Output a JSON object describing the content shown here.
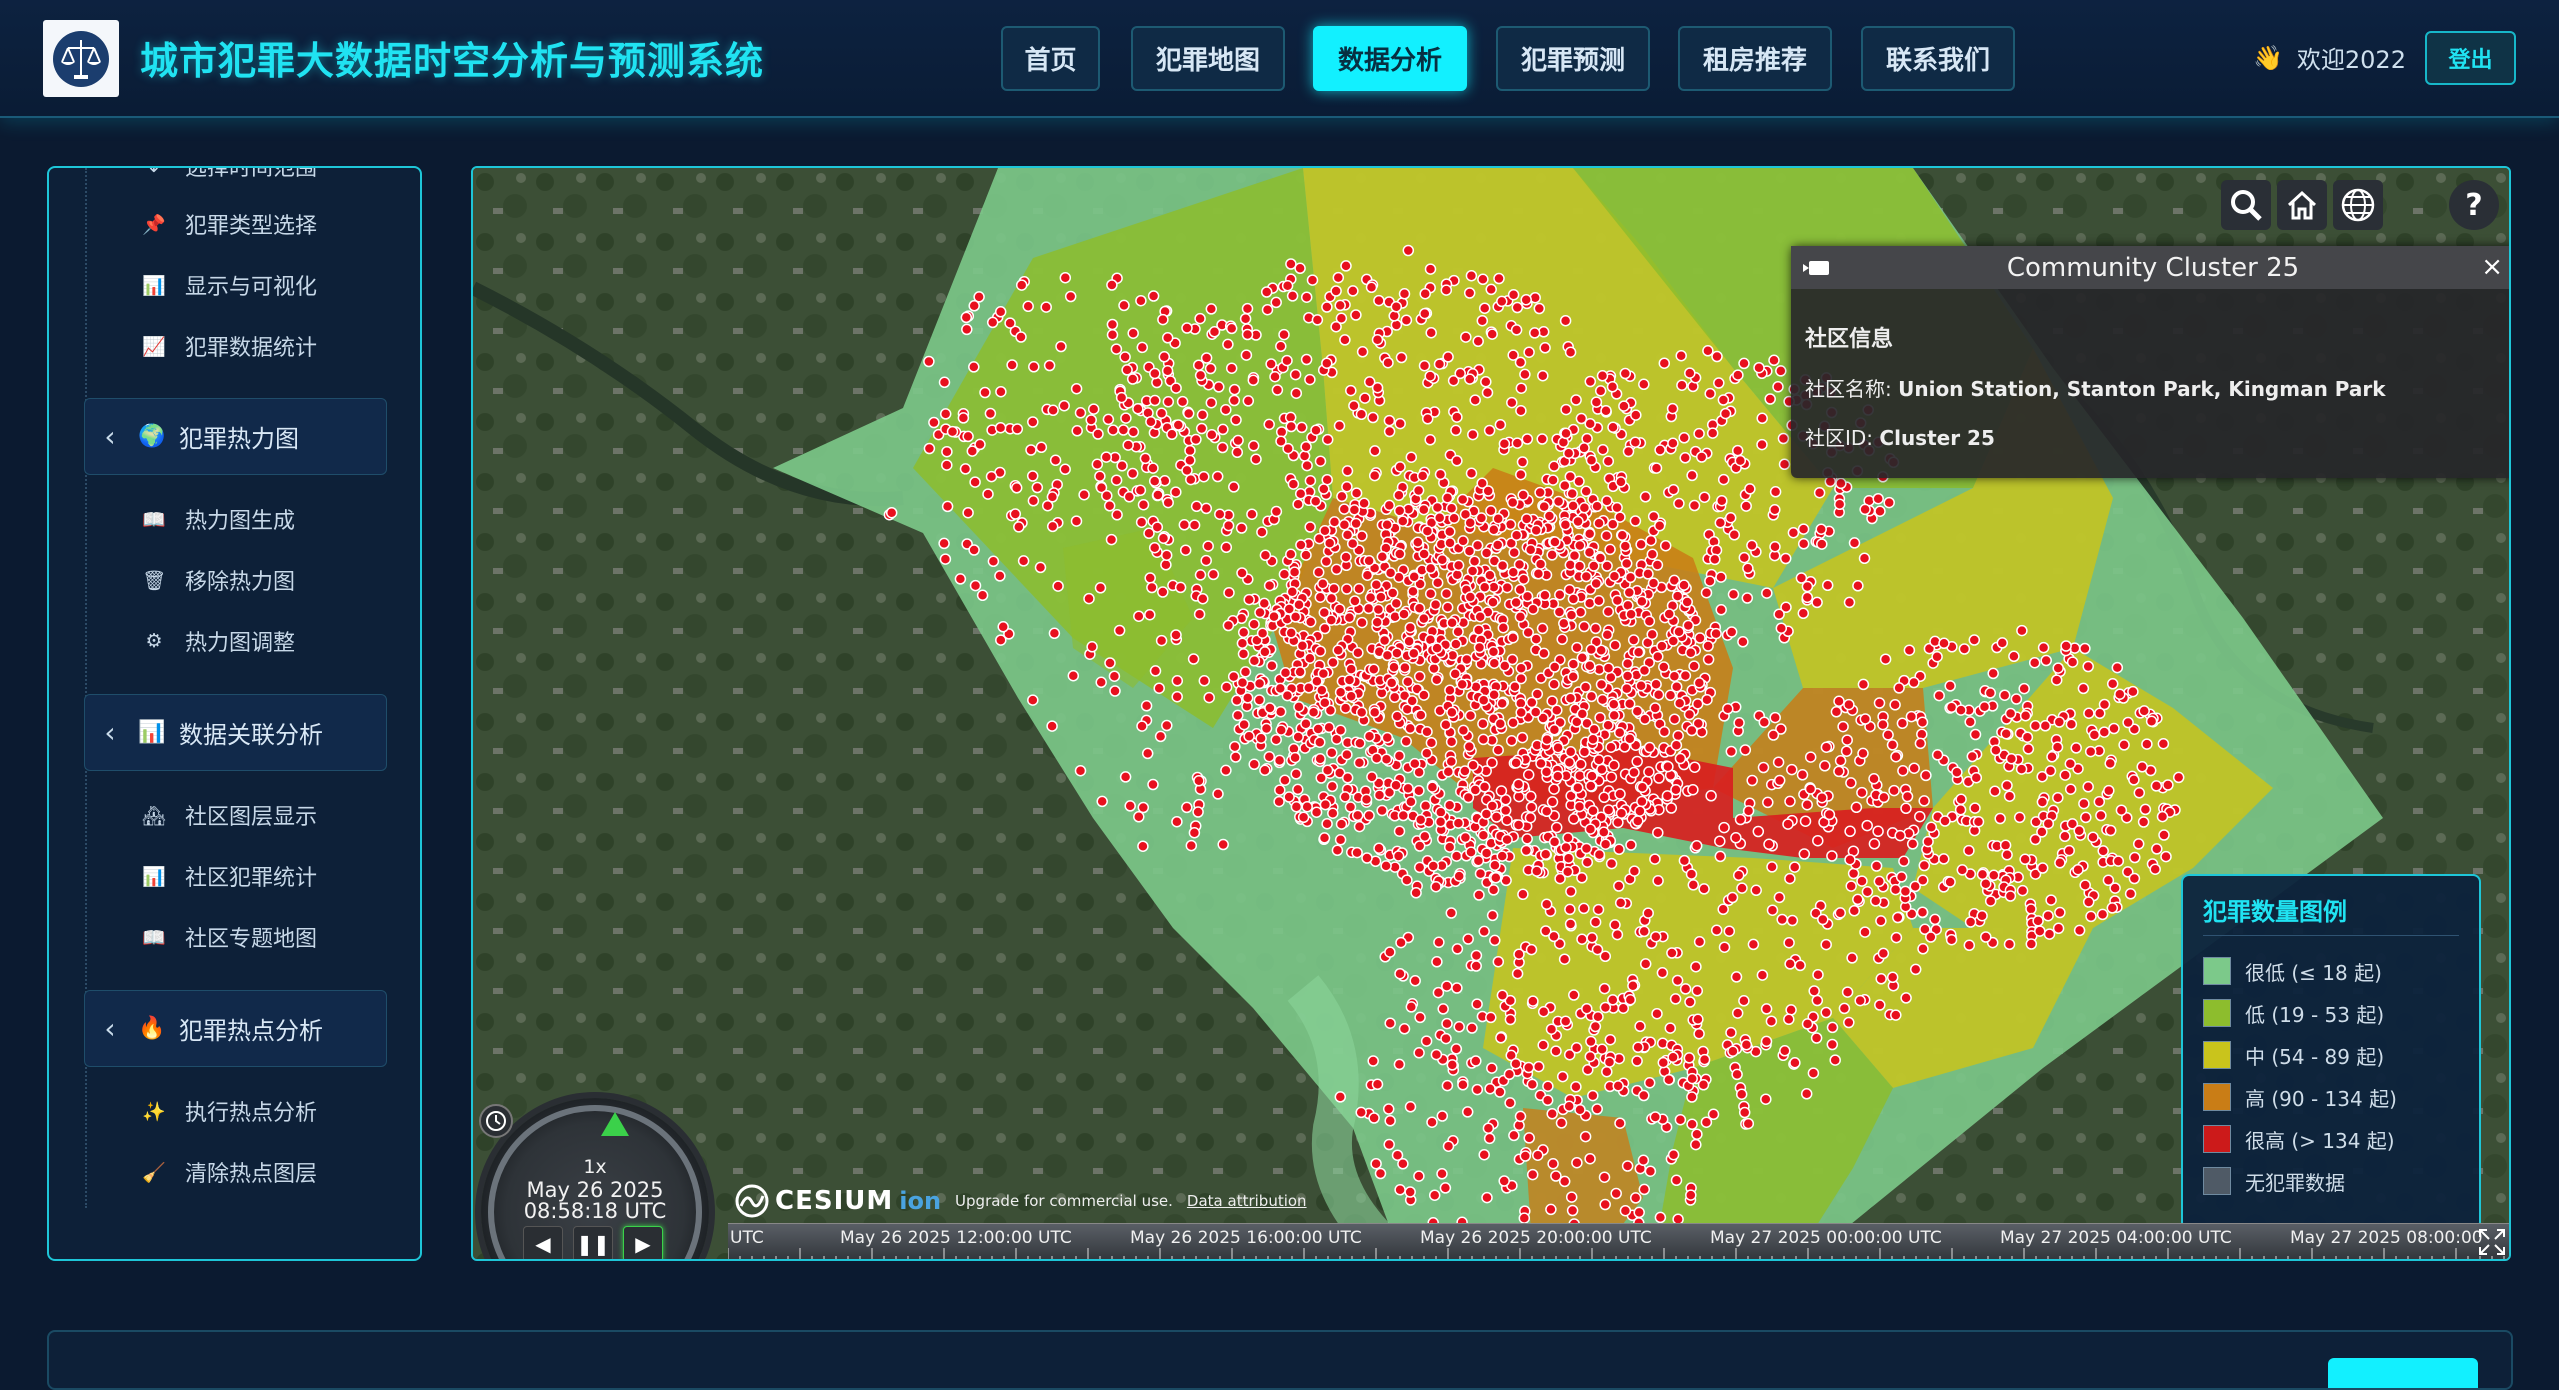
{
  "header": {
    "title": "城市犯罪大数据时空分析与预测系统",
    "welcome": "欢迎2022",
    "logout": "登出"
  },
  "nav": [
    {
      "label": "首页",
      "active": false
    },
    {
      "label": "犯罪地图",
      "active": false
    },
    {
      "label": "数据分析",
      "active": true
    },
    {
      "label": "犯罪预测",
      "active": false
    },
    {
      "label": "租房推荐",
      "active": false
    },
    {
      "label": "联系我们",
      "active": false
    }
  ],
  "sidebar": {
    "top_partial": "选择时间范围",
    "items_a": [
      {
        "label": "犯罪类型选择",
        "icon": "pushpin"
      },
      {
        "label": "显示与可视化",
        "icon": "bar-chart"
      },
      {
        "label": "犯罪数据统计",
        "icon": "trend-chart"
      }
    ],
    "group_heatmap": {
      "label": "犯罪热力图",
      "icon": "globe"
    },
    "items_b": [
      {
        "label": "热力图生成",
        "icon": "map-book"
      },
      {
        "label": "移除热力图",
        "icon": "wastebasket"
      },
      {
        "label": "热力图调整",
        "icon": "gear"
      }
    ],
    "group_correlation": {
      "label": "数据关联分析",
      "icon": "bar-chart"
    },
    "items_c": [
      {
        "label": "社区图层显示",
        "icon": "houses"
      },
      {
        "label": "社区犯罪统计",
        "icon": "bar-chart"
      },
      {
        "label": "社区专题地图",
        "icon": "map-book"
      }
    ],
    "group_hotspot": {
      "label": "犯罪热点分析",
      "icon": "fire"
    },
    "items_d": [
      {
        "label": "执行热点分析",
        "icon": "sparkles"
      },
      {
        "label": "清除热点图层",
        "icon": "broom"
      }
    ]
  },
  "map": {
    "infobox": {
      "title": "Community Cluster 25",
      "close": "×",
      "heading": "社区信息",
      "name_label": "社区名称: ",
      "name_value": "Union Station, Stanton Park, Kingman Park",
      "id_label": "社区ID: ",
      "id_value": "Cluster 25"
    },
    "legend": {
      "title": "犯罪数量图例",
      "items": [
        {
          "label": "很低 (≤ 18 起)",
          "color": "#7cc98a"
        },
        {
          "label": "低 (19 - 53 起)",
          "color": "#8dbd2d"
        },
        {
          "label": "中 (54 - 89 起)",
          "color": "#c9c41c"
        },
        {
          "label": "高 (90 - 134 起)",
          "color": "#c97d16"
        },
        {
          "label": "很高 (> 134 起)",
          "color": "#cc1a1a"
        },
        {
          "label": "无犯罪数据",
          "color": "#4f5a66"
        }
      ]
    },
    "clock": {
      "speed": "1x",
      "date": "May 26 2025",
      "time": "08:58:18 UTC"
    },
    "credits": {
      "logo": "CESIUM",
      "ion": "ion",
      "upgrade": "Upgrade for commercial use.",
      "attribution": "Data attribution"
    },
    "timeline": [
      "UTC",
      "May 26 2025 12:00:00 UTC",
      "May 26 2025 16:00:00 UTC",
      "May 26 2025 20:00:00 UTC",
      "May 27 2025 00:00:00 UTC",
      "May 27 2025 04:00:00 UTC",
      "May 27 2025 08:00:00"
    ]
  }
}
